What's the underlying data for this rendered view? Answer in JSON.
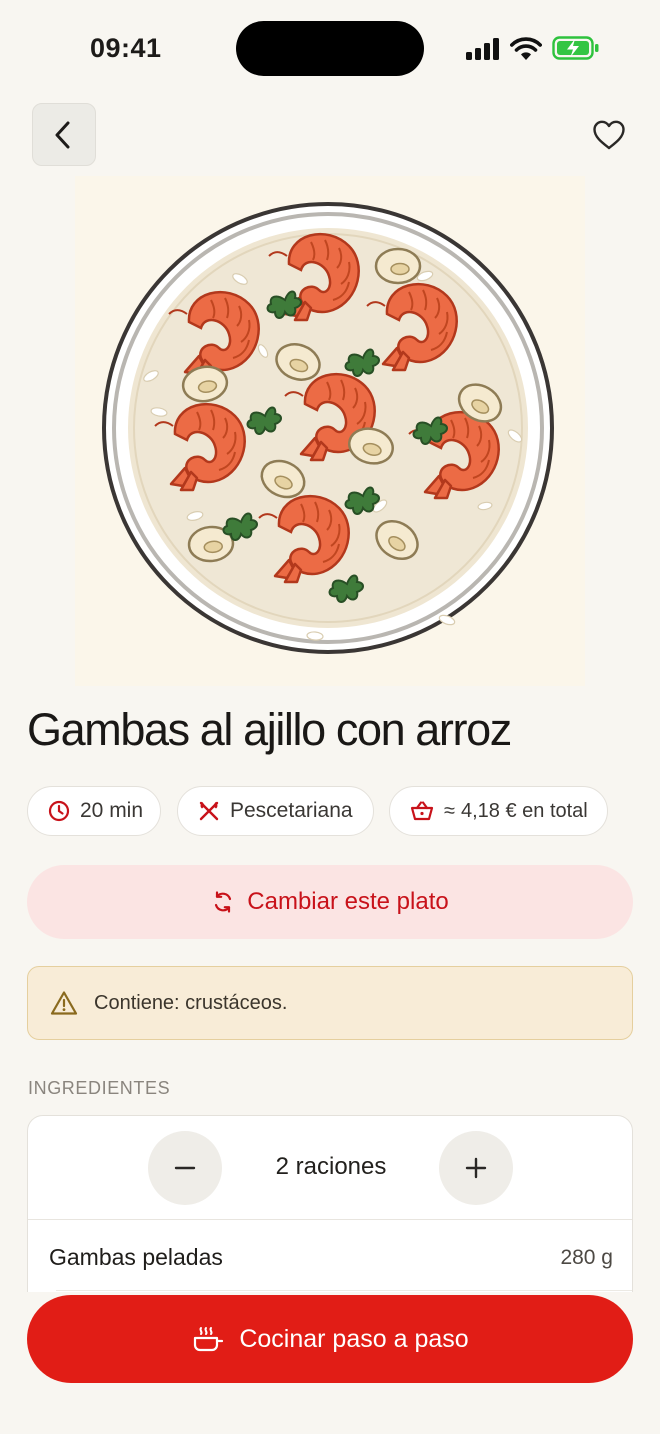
{
  "status_bar": {
    "time": "09:41"
  },
  "nav": {
    "back_icon": "chevron-left-icon",
    "favorite_icon": "heart-outline-icon"
  },
  "recipe": {
    "image_alt": "Ilustración de gambas al ajillo sobre arroz con perejil y ajo",
    "title": "Gambas al ajillo con arroz",
    "chips": {
      "time": "20 min",
      "diet": "Pescetariana",
      "cost_prefix": "≈",
      "cost": "4,18 € en total"
    },
    "swap_label": "Cambiar este plato",
    "allergy_text": "Contiene: crustáceos."
  },
  "ingredients": {
    "section_label": "INGREDIENTES",
    "servings_label": "2 raciones",
    "items": [
      {
        "name": "Gambas peladas",
        "qty": "280 g"
      }
    ]
  },
  "cta": {
    "label": "Cocinar paso a paso"
  },
  "colors": {
    "background": "#f8f6f1",
    "accent": "#e11d16",
    "accent_soft": "#fbe4e3",
    "warning_bg": "#f8ecd7",
    "warning_border": "#e5cf9e"
  }
}
